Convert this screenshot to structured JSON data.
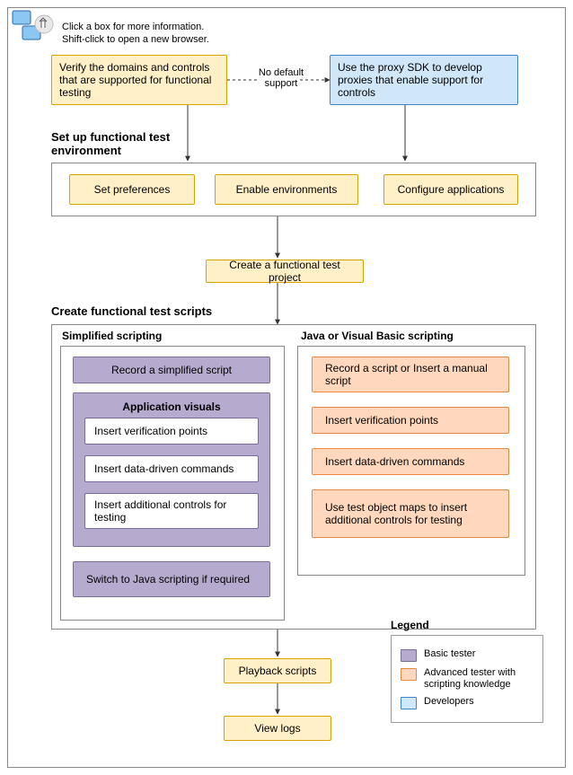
{
  "hint": {
    "line1": "Click a box for more information.",
    "line2": "Shift-click to open a new browser."
  },
  "top": {
    "verify": "Verify the domains and controls that are supported for functional testing",
    "no_default": "No default support",
    "proxy": "Use the proxy SDK to develop proxies that enable support for controls"
  },
  "setup": {
    "title": "Set up functional test environment",
    "set_prefs": "Set preferences",
    "enable_env": "Enable environments",
    "config_apps": "Configure applications"
  },
  "create_project": "Create a functional test project",
  "scripts": {
    "title": "Create functional test scripts",
    "simplified": {
      "title": "Simplified scripting",
      "record": "Record a simplified script",
      "app_visuals": "Application visuals",
      "insert_vp": "Insert verification points",
      "insert_dd": "Insert data-driven commands",
      "insert_ctrl": "Insert additional controls for testing",
      "switch": "Switch to Java scripting if required"
    },
    "java": {
      "title": "Java or Visual Basic scripting",
      "record": "Record a script or Insert a manual script",
      "insert_vp": "Insert verification points",
      "insert_dd": "Insert data-driven commands",
      "maps": "Use test object maps to insert additional controls for testing"
    }
  },
  "playback": "Playback scripts",
  "viewlogs": "View logs",
  "legend": {
    "title": "Legend",
    "basic": "Basic tester",
    "advanced": "Advanced tester with scripting knowledge",
    "dev": "Developers"
  },
  "colors": {
    "yellow": "#fff0c8",
    "blue": "#cfe7f9",
    "purple": "#b7aacf",
    "orange": "#ffd8bd"
  }
}
